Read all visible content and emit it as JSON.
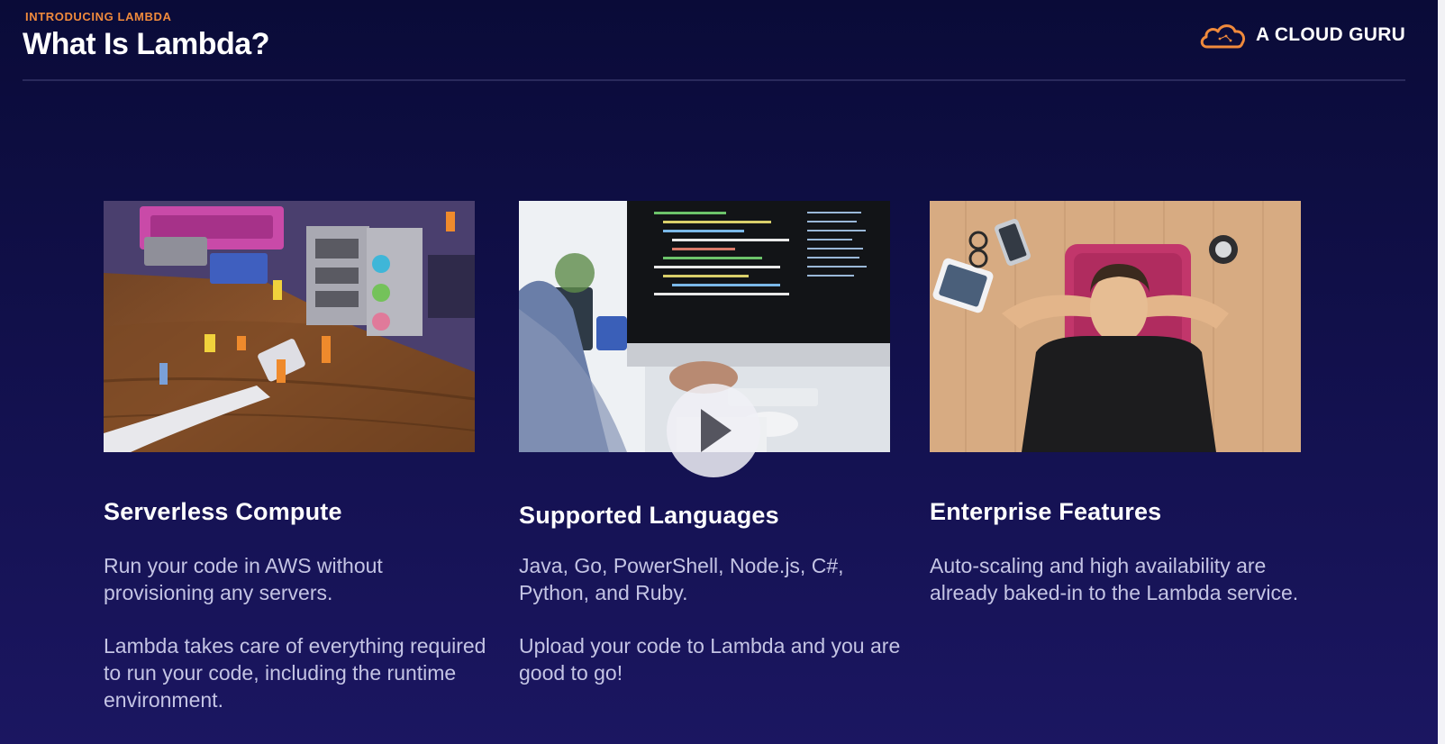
{
  "header": {
    "eyebrow": "INTRODUCING LAMBDA",
    "title": "What Is Lambda?",
    "brand_name": "A CLOUD GURU",
    "brand_icon": "cloud-logo-icon",
    "accent_color": "#f08a3c"
  },
  "cards": [
    {
      "title": "Serverless Compute",
      "paragraphs": [
        "Run your code in AWS without provisioning any servers.",
        "Lambda takes care of everything required to run your code, including the runtime environment."
      ],
      "image": "miniature-workers-motherboard-image"
    },
    {
      "title": "Supported Languages",
      "paragraphs": [
        "Java, Go, PowerShell, Node.js, C#, Python, and Ruby.",
        "Upload your code to Lambda and you are good to go!"
      ],
      "image": "developer-coding-monitor-image"
    },
    {
      "title": "Enterprise Features",
      "paragraphs": [
        "Auto-scaling and high availability are already baked-in to the Lambda service."
      ],
      "image": "man-relaxing-on-floor-image"
    }
  ],
  "video": {
    "play_icon": "play-icon"
  }
}
